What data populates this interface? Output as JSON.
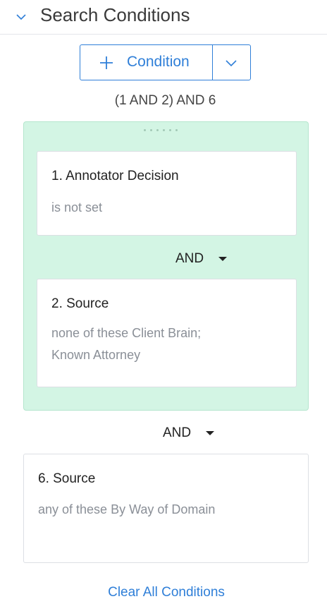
{
  "header": {
    "title": "Search Conditions",
    "chevron_icon": "chevron-down-icon"
  },
  "add_condition": {
    "label": "Condition",
    "icon": "plus-icon",
    "dropdown_icon": "chevron-down-icon"
  },
  "expression": "(1 AND 2) AND 6",
  "group": {
    "operator": "AND",
    "conditions": [
      {
        "title": "1. Annotator Decision",
        "description": "is not set"
      },
      {
        "title": "2. Source",
        "description": "none of these Client Brain; Known Attorney"
      }
    ]
  },
  "outer_operator": "AND",
  "standalone_condition": {
    "title": "6. Source",
    "description": "any of these By Way of Domain"
  },
  "clear_all_label": "Clear All Conditions",
  "colors": {
    "accent": "#2f7fd8",
    "group_background": "#d3f5e4",
    "muted_text": "#8a8f97"
  }
}
